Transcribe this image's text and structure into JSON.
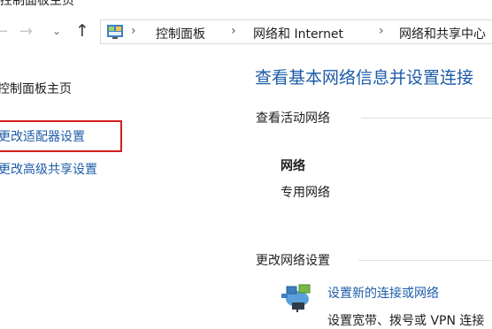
{
  "window": {
    "title": "控制面板主页"
  },
  "nav": {
    "back_glyph": "←",
    "forward_glyph": "→",
    "dropdown_glyph": "⌄",
    "up_glyph": "↑"
  },
  "address_bar": {
    "icon": "control-panel-icon",
    "separator": "›",
    "crumbs": [
      "控制面板",
      "网络和 Internet",
      "网络和共享中心"
    ]
  },
  "sidebar": {
    "items": [
      {
        "label": "控制面板主页"
      },
      {
        "label": "更改适配器设置",
        "highlighted": true
      },
      {
        "label": "更改高级共享设置"
      }
    ],
    "highlight_color": "#d21e1e"
  },
  "main": {
    "title": "查看基本网络信息并设置连接",
    "active_networks": {
      "heading": "查看活动网络",
      "network_name": "网络",
      "network_type": "专用网络"
    },
    "change_settings": {
      "heading": "更改网络设置",
      "action_icon": "network-setup-icon",
      "action_link": "设置新的连接或网络",
      "action_desc": "设置宽带、拨号或 VPN 连接"
    }
  },
  "colors": {
    "link": "#1d5ca8",
    "text": "#1e1e1e",
    "highlight": "#d21e1e"
  }
}
